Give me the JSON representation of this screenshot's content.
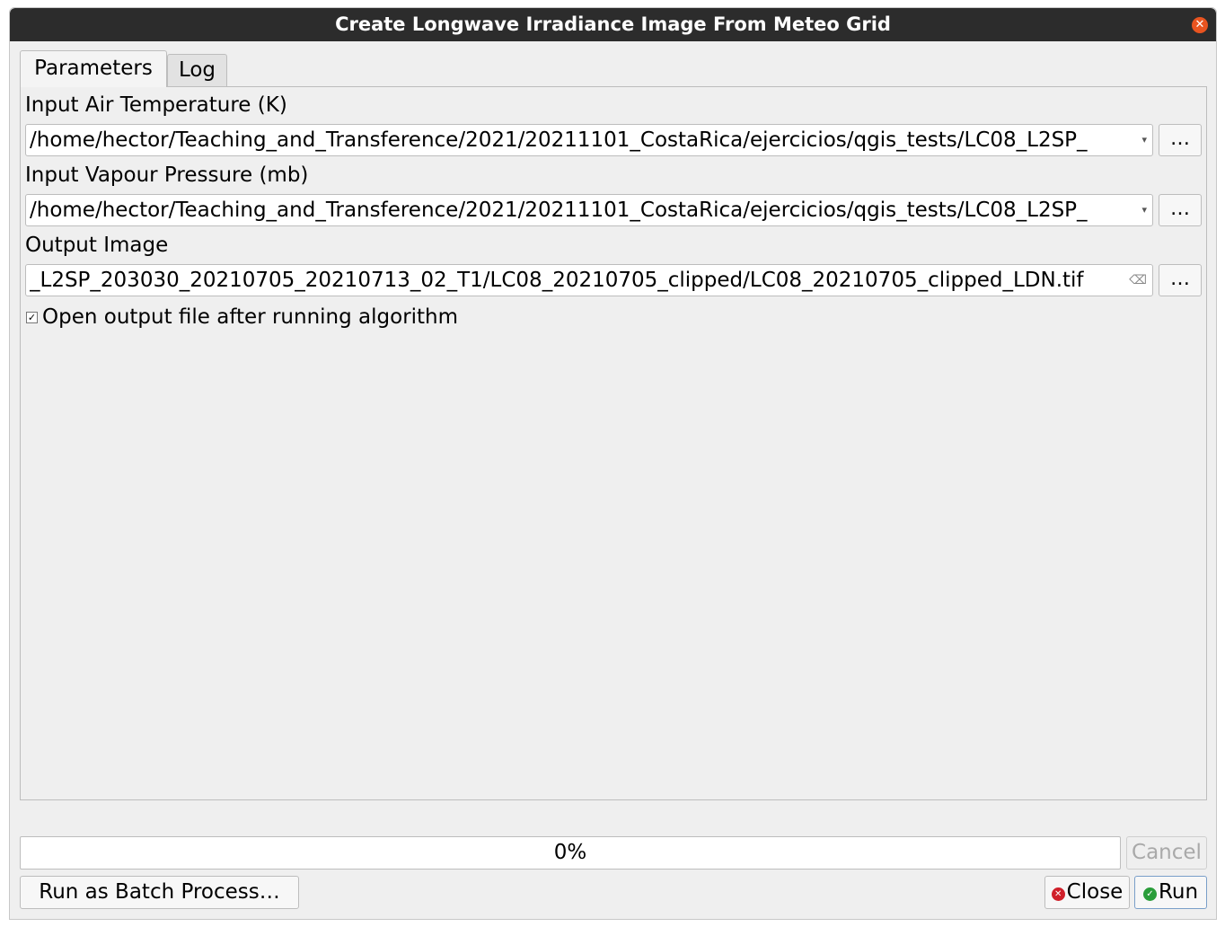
{
  "window": {
    "title": "Create Longwave Irradiance Image From Meteo Grid"
  },
  "tabs": [
    {
      "label": "Parameters",
      "active": true
    },
    {
      "label": "Log",
      "active": false
    }
  ],
  "params": {
    "air_temp": {
      "label": "Input Air Temperature (K)",
      "value": "/home/hector/Teaching_and_Transference/2021/20211101_CostaRica/ejercicios/qgis_tests/LC08_L2SP_"
    },
    "vapour": {
      "label": "Input Vapour Pressure (mb)",
      "value": "/home/hector/Teaching_and_Transference/2021/20211101_CostaRica/ejercicios/qgis_tests/LC08_L2SP_"
    },
    "output": {
      "label": "Output Image",
      "value": "_L2SP_203030_20210705_20210713_02_T1/LC08_20210705_clipped/LC08_20210705_clipped_LDN.tif"
    },
    "browse_label": "…",
    "open_output": {
      "label": "Open output file after running algorithm",
      "checked": true
    }
  },
  "footer": {
    "progress_text": "0%",
    "progress_value": 0,
    "cancel_label": "Cancel",
    "batch_label": "Run as Batch Process…",
    "close_label": "Close",
    "run_label": "Run"
  }
}
